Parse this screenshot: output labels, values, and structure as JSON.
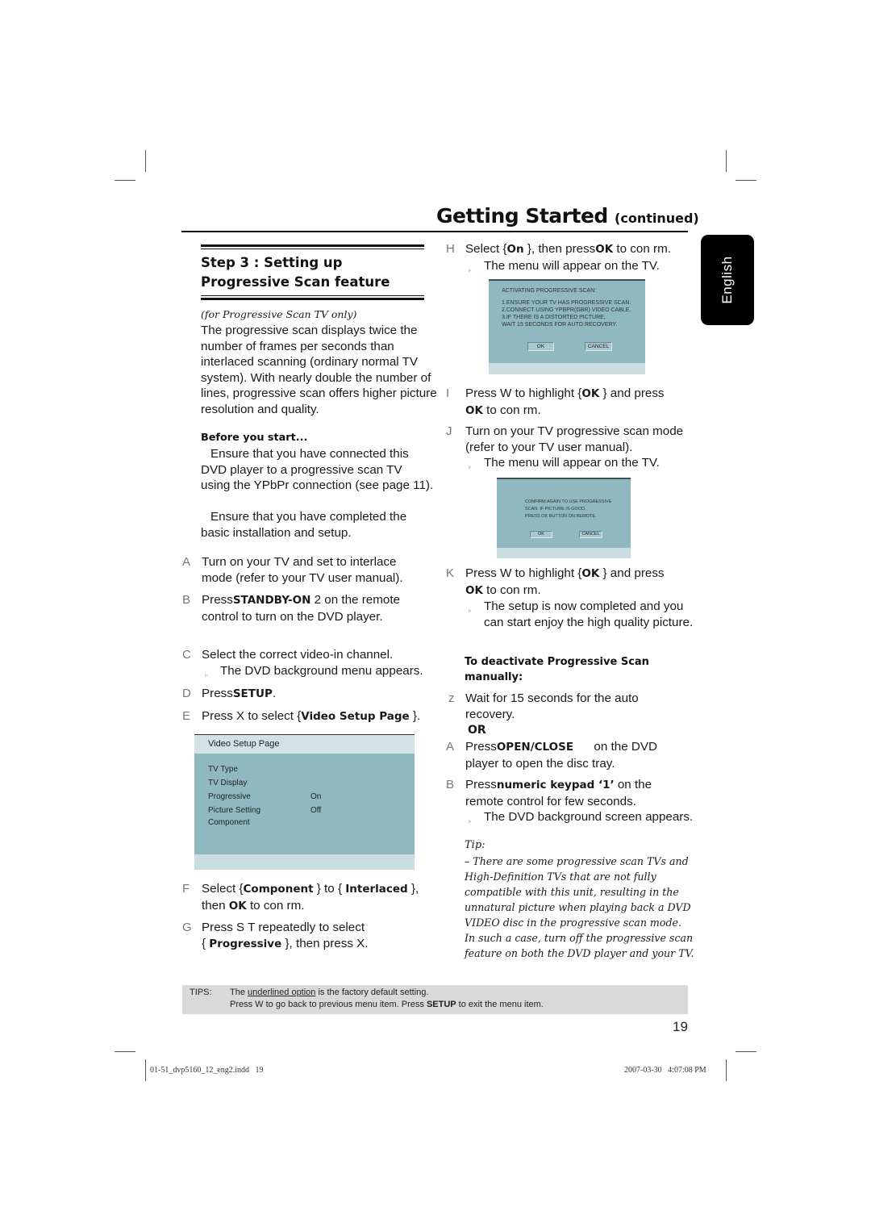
{
  "header": {
    "title": "Getting Started",
    "continued": "(continued)",
    "language_tab": "English"
  },
  "left": {
    "step_title_line1": "Step 3 : Setting up",
    "step_title_line2": "Progressive Scan feature",
    "subtitle": "(for Progressive Scan TV only)",
    "intro": "The progressive scan displays twice the number of frames per seconds than interlaced scanning (ordinary normal TV system). With nearly double the number of lines, progressive scan offers higher picture resolution and quality.",
    "before_heading": "Before you start...",
    "before_1": "Ensure that you have connected this DVD player to a progressive scan TV using the YPbPr connection (see page 11).",
    "before_2": "Ensure that you have completed the basic installation and setup.",
    "steps": [
      {
        "letter": "A",
        "text": "Turn on your TV and set to interlace mode (refer to your TV user manual)."
      },
      {
        "letter": "B",
        "pre": "Press",
        "bold": "STANDBY-ON",
        "post": " 2   on the remote control to turn on the DVD player."
      },
      {
        "letter": "C",
        "text": "Select the correct video-in channel.",
        "sub": "The DVD background menu appears."
      },
      {
        "letter": "D",
        "pre": "Press",
        "bold": "SETUP",
        "post": "."
      },
      {
        "letter": "E",
        "pre": "Press X to select {",
        "bold": "Video Setup Page",
        "post": " }."
      },
      {
        "letter": "F",
        "pre": "Select {",
        "bold": "Component",
        "mid": " } to { ",
        "bold2": "Interlaced",
        "post": " },",
        "line2_pre": "then ",
        "line2_bold": "OK",
        "line2_post": " to con rm."
      },
      {
        "letter": "G",
        "text": "Press S  T repeatedly to select",
        "line2_pre": "{ ",
        "line2_bold": "Progressive",
        "line2_post": " }, then press X."
      }
    ],
    "video_setup_menu": {
      "header": "Video Setup Page",
      "rows": [
        {
          "label": "TV Type",
          "value": ""
        },
        {
          "label": "TV Display",
          "value": ""
        },
        {
          "label": "Progressive",
          "value": "On"
        },
        {
          "label": "Picture Setting",
          "value": "Off"
        },
        {
          "label": "Component",
          "value": ""
        }
      ]
    }
  },
  "right": {
    "steps": [
      {
        "letter": "H",
        "pre": "Select {",
        "bold": "On",
        "post": " }, then press",
        "bold2": "OK",
        "post2": " to con rm.",
        "sub": "The menu will appear on the TV."
      },
      {
        "letter": "I",
        "pre": "Press W to highlight {",
        "bold": "OK",
        "post": " } and press",
        "line2_bold": "OK",
        "line2_post": " to con rm."
      },
      {
        "letter": "J",
        "text": "Turn on your TV progressive scan mode (refer to your TV user manual).",
        "sub": "The menu will appear on the TV."
      },
      {
        "letter": "K",
        "pre": "Press W to highlight {",
        "bold": "OK",
        "post": " } and press",
        "line2_bold": "OK",
        "line2_post": " to con rm.",
        "sub": "The setup is now completed and you can start enjoy the high quality picture."
      }
    ],
    "tv_menu_1": {
      "title": "ACTIVATING PROGRESSIVE SCAN:",
      "line1": "1.ENSURE  YOUR  TV  HAS  PROGRESSIVE  SCAN.",
      "line2": "2.CONNECT  USING  YPBPR(GBR)  VIDEO  CABLE.",
      "line3": "3.IF  THERE  IS  A  DISTORTED  PICTURE,",
      "line4": "WAIT  15  SECONDS  FOR  AUTO  RECOVERY.",
      "ok": "OK",
      "cancel": "CANCEL"
    },
    "tv_menu_2": {
      "line1": "CONFIRM AGAIN TO USE PROGRESSIVE",
      "line2": "SCAN. IF PICTURE IS GOOD,",
      "line3": "PRESS OK BUTTON ON REMOTE.",
      "ok": "OK",
      "cancel": "CANCEL"
    },
    "deactivate_heading_1": "To deactivate Progressive Scan",
    "deactivate_heading_2": "manually:",
    "deactivate_steps": [
      {
        "letter": "z",
        "text": "Wait for 15 seconds for the auto recovery."
      },
      {
        "or": "OR"
      },
      {
        "letter": "A",
        "pre": "Press",
        "bold": "OPEN/CLOSE",
        "post": "      on the DVD",
        "line2": "player to open the disc tray."
      },
      {
        "letter": "B",
        "pre": "Press",
        "bold": "numeric keypad ‘1’",
        "post": " on the",
        "line2": "remote control for few seconds.",
        "sub": "The DVD background screen appears."
      }
    ],
    "tip_label": "Tip:",
    "tip_text": "– There are some progressive scan TVs and High-Definition TVs that are not fully compatible with this unit, resulting in the unnatural picture when playing back a DVD VIDEO disc in the progressive scan mode. In such a case, turn off the progressive scan feature on both the DVD player and your TV."
  },
  "tips_bar": {
    "label": "TIPS:",
    "line1_pre": "The ",
    "line1_underlined": "underlined option",
    "line1_post": " is the factory default setting.",
    "line2_pre": "Press  W to go back to previous menu item. Press ",
    "line2_bold": "SETUP",
    "line2_post": " to exit the menu item."
  },
  "footer": {
    "page_number": "19",
    "slug_file": "01-51_dvp5160_12_eng2.indd   19",
    "slug_date": "2007-03-30   4:07:08 PM"
  }
}
